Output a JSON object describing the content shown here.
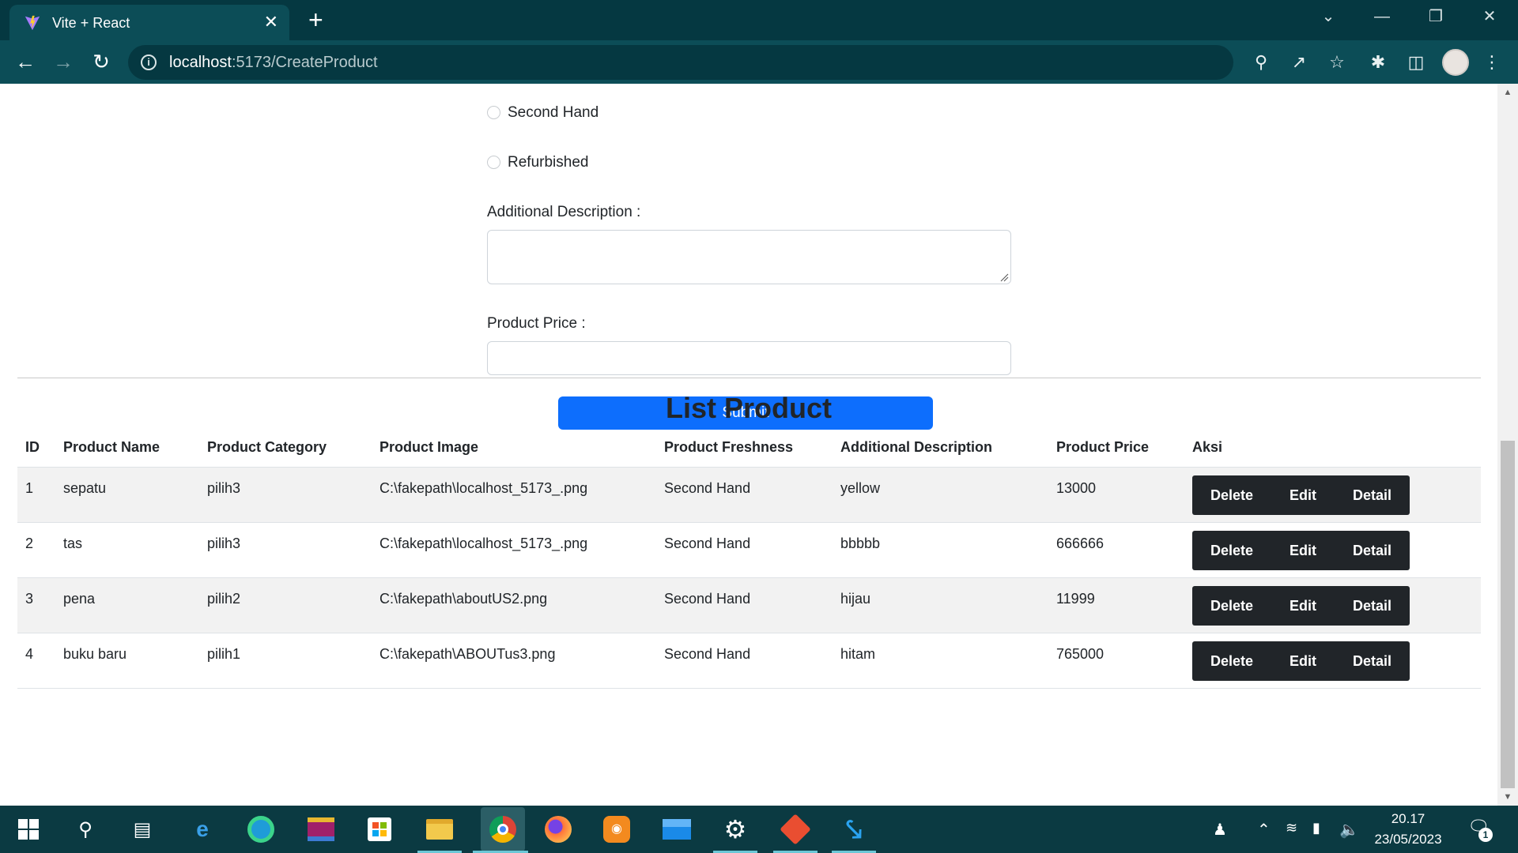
{
  "browser": {
    "tab_title": "Vite + React",
    "tab_close": "✕",
    "new_tab": "+",
    "url_host": "localhost",
    "url_path": ":5173/CreateProduct",
    "window_controls": [
      "⌄",
      "—",
      "❐",
      "✕"
    ]
  },
  "form": {
    "radio_options": [
      "Second Hand",
      "Refurbished"
    ],
    "additional_description_label": "Additional Description :",
    "additional_description_value": "",
    "product_price_label": "Product Price :",
    "product_price_value": "",
    "submit_label": "Submit"
  },
  "list": {
    "title": "List Product",
    "columns": [
      "ID",
      "Product Name",
      "Product Category",
      "Product Image",
      "Product Freshness",
      "Additional Description",
      "Product Price",
      "Aksi"
    ],
    "rows": [
      {
        "id": "1",
        "name": "sepatu",
        "category": "pilih3",
        "image": "C:\\fakepath\\localhost_5173_.png",
        "freshness": "Second Hand",
        "description": "yellow",
        "price": "13000"
      },
      {
        "id": "2",
        "name": "tas",
        "category": "pilih3",
        "image": "C:\\fakepath\\localhost_5173_.png",
        "freshness": "Second Hand",
        "description": "bbbbb",
        "price": "666666"
      },
      {
        "id": "3",
        "name": "pena",
        "category": "pilih2",
        "image": "C:\\fakepath\\aboutUS2.png",
        "freshness": "Second Hand",
        "description": "hijau",
        "price": "11999"
      },
      {
        "id": "4",
        "name": "buku baru",
        "category": "pilih1",
        "image": "C:\\fakepath\\ABOUTus3.png",
        "freshness": "Second Hand",
        "description": "hitam",
        "price": "765000"
      }
    ],
    "actions": {
      "delete": "Delete",
      "edit": "Edit",
      "detail": "Detail"
    }
  },
  "taskbar": {
    "time": "20.17",
    "date": "23/05/2023",
    "notification_count": "1",
    "apps": [
      "windows-start",
      "search",
      "task-view",
      "edge-legacy",
      "edge",
      "winrar",
      "store",
      "file-explorer",
      "chrome",
      "firefox",
      "uc-browser",
      "mail",
      "settings",
      "git",
      "vscode"
    ]
  }
}
